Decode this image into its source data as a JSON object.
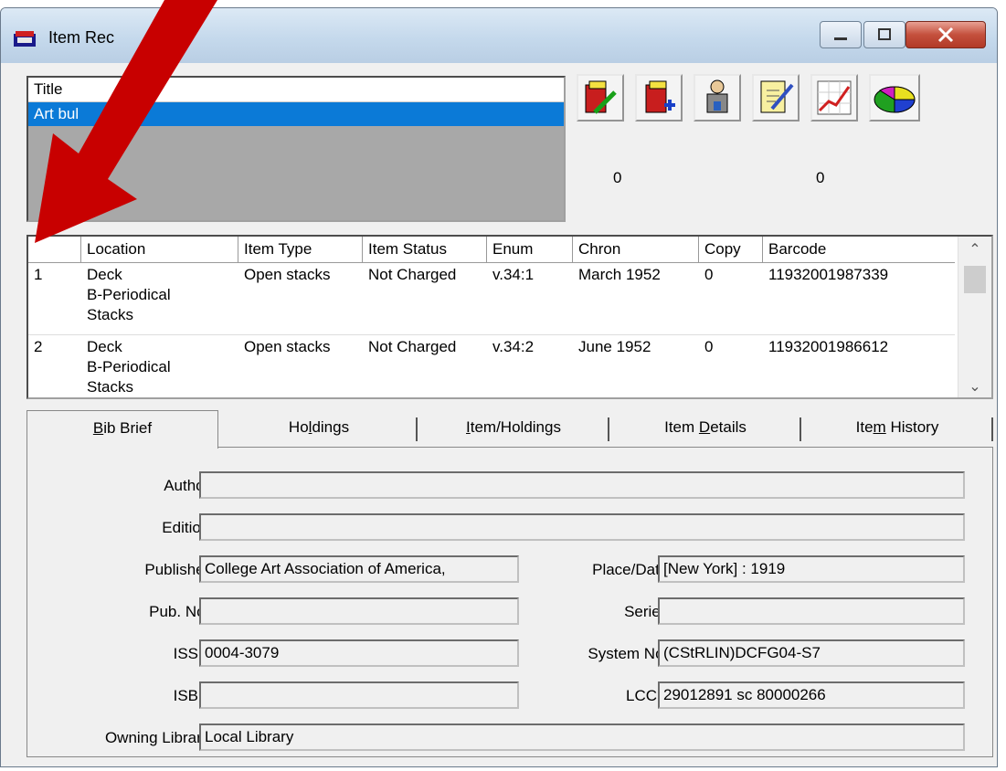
{
  "window": {
    "title": "Item Rec"
  },
  "title_list": {
    "header": "Title",
    "selected": "Art bul"
  },
  "toolbar": {
    "buttons": [
      {
        "name": "repair-item-icon"
      },
      {
        "name": "add-item-icon"
      },
      {
        "name": "patron-icon"
      },
      {
        "name": "notes-icon"
      },
      {
        "name": "chart-icon"
      },
      {
        "name": "pie-chart-icon"
      }
    ],
    "counts": [
      "0",
      "0"
    ]
  },
  "grid": {
    "columns": [
      "",
      "Location",
      "Item Type",
      "Item Status",
      "Enum",
      "Chron",
      "Copy",
      "Barcode"
    ],
    "rows": [
      {
        "num": "1",
        "location": "Deck\nB-Periodical\nStacks",
        "item_type": "Open stacks",
        "item_status": "Not Charged",
        "enum": "v.34:1",
        "chron": "March 1952",
        "copy": "0",
        "barcode": "11932001987339"
      },
      {
        "num": "2",
        "location": "Deck\nB-Periodical\nStacks",
        "item_type": "Open stacks",
        "item_status": "Not Charged",
        "enum": "v.34:2",
        "chron": "June 1952",
        "copy": "0",
        "barcode": "11932001986612"
      }
    ]
  },
  "tabs": [
    {
      "pre": "",
      "u": "B",
      "post": "ib Brief"
    },
    {
      "pre": "Ho",
      "u": "l",
      "post": "dings"
    },
    {
      "pre": "",
      "u": "I",
      "post": "tem/Holdings"
    },
    {
      "pre": "Item ",
      "u": "D",
      "post": "etails"
    },
    {
      "pre": "Ite",
      "u": "m",
      "post": " History"
    }
  ],
  "bib": {
    "author_label": "Author:",
    "author": "",
    "edition_label": "Edition:",
    "edition": "",
    "publisher_label": "Publisher:",
    "publisher": "College Art Association of America,",
    "place_label": "Place/Date:",
    "place": "[New York] : 1919",
    "pubno_label": "Pub. No.:",
    "pubno": "",
    "series_label": "Series:",
    "series": "",
    "issn_label": "ISSN:",
    "issn": "0004-3079",
    "sysno_label": "System No.:",
    "sysno": "(CStRLIN)DCFG04-S7",
    "isbn_label": "ISBN:",
    "isbn": "",
    "lccn_label": "LCCN:",
    "lccn": "29012891 sc 80000266",
    "owning_label": "Owning Library:",
    "owning": "Local Library"
  },
  "colors": {
    "selection": "#0b7ad7",
    "arrow": "#c80000"
  }
}
